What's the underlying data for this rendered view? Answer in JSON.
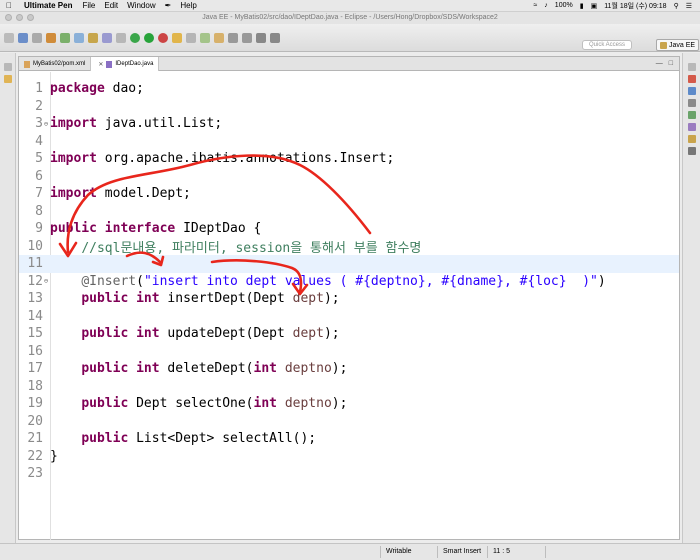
{
  "menubar": {
    "apple": "",
    "app_name": "Ultimate Pen",
    "items": [
      "File",
      "Edit",
      "Window",
      "Help"
    ],
    "battery": "100%",
    "datetime": "11월 18일 (수)  09:18"
  },
  "window": {
    "title": "Java EE - MyBatis02/src/dao/IDeptDao.java - Eclipse - /Users/Hong/Dropbox/SDS/Workspace2"
  },
  "toolbar": {
    "quick_access_placeholder": "Quick Access",
    "perspective_label": "Java EE"
  },
  "editor": {
    "tabs": [
      {
        "label": "MyBatis02/pom.xml",
        "active": false
      },
      {
        "label": "IDeptDao.java",
        "active": true
      }
    ],
    "current_line": 11,
    "lines": [
      {
        "n": "1",
        "fold": "",
        "tokens": [
          {
            "t": "package",
            "c": "kw"
          },
          {
            "t": " dao;",
            "c": ""
          }
        ]
      },
      {
        "n": "2",
        "fold": "",
        "tokens": []
      },
      {
        "n": "3",
        "fold": "⊖",
        "tokens": [
          {
            "t": "import",
            "c": "kw"
          },
          {
            "t": " java.util.List;",
            "c": ""
          }
        ]
      },
      {
        "n": "4",
        "fold": "",
        "tokens": []
      },
      {
        "n": "5",
        "fold": "",
        "tokens": [
          {
            "t": "import",
            "c": "kw"
          },
          {
            "t": " org.apache.ibatis.annotations.Insert;",
            "c": ""
          }
        ]
      },
      {
        "n": "6",
        "fold": "",
        "tokens": []
      },
      {
        "n": "7",
        "fold": "",
        "tokens": [
          {
            "t": "import",
            "c": "kw"
          },
          {
            "t": " model.Dept;",
            "c": ""
          }
        ]
      },
      {
        "n": "8",
        "fold": "",
        "tokens": []
      },
      {
        "n": "9",
        "fold": "",
        "tokens": [
          {
            "t": "public",
            "c": "kw"
          },
          {
            "t": " ",
            "c": ""
          },
          {
            "t": "interface",
            "c": "kw"
          },
          {
            "t": " IDeptDao {",
            "c": ""
          }
        ]
      },
      {
        "n": "10",
        "fold": "",
        "tokens": [
          {
            "t": "    ",
            "c": ""
          },
          {
            "t": "//sql문내용, 파라미터, session을 통해서 부를 함수명",
            "c": "cm"
          }
        ]
      },
      {
        "n": "11",
        "fold": "",
        "tokens": []
      },
      {
        "n": "12",
        "fold": "⊖",
        "tokens": [
          {
            "t": "    ",
            "c": ""
          },
          {
            "t": "@Insert",
            "c": "ann"
          },
          {
            "t": "(",
            "c": ""
          },
          {
            "t": "\"insert into dept values ( #{deptno}, #{dname}, #{loc}  )\"",
            "c": "str"
          },
          {
            "t": ")",
            "c": ""
          }
        ]
      },
      {
        "n": "13",
        "fold": "",
        "tokens": [
          {
            "t": "    ",
            "c": ""
          },
          {
            "t": "public",
            "c": "kw"
          },
          {
            "t": " ",
            "c": ""
          },
          {
            "t": "int",
            "c": "kw"
          },
          {
            "t": " insertDept(Dept ",
            "c": ""
          },
          {
            "t": "dept",
            "c": "var"
          },
          {
            "t": ");",
            "c": ""
          }
        ]
      },
      {
        "n": "14",
        "fold": "",
        "tokens": []
      },
      {
        "n": "15",
        "fold": "",
        "tokens": [
          {
            "t": "    ",
            "c": ""
          },
          {
            "t": "public",
            "c": "kw"
          },
          {
            "t": " ",
            "c": ""
          },
          {
            "t": "int",
            "c": "kw"
          },
          {
            "t": " updateDept(Dept ",
            "c": ""
          },
          {
            "t": "dept",
            "c": "var"
          },
          {
            "t": ");",
            "c": ""
          }
        ]
      },
      {
        "n": "16",
        "fold": "",
        "tokens": []
      },
      {
        "n": "17",
        "fold": "",
        "tokens": [
          {
            "t": "    ",
            "c": ""
          },
          {
            "t": "public",
            "c": "kw"
          },
          {
            "t": " ",
            "c": ""
          },
          {
            "t": "int",
            "c": "kw"
          },
          {
            "t": " deleteDept(",
            "c": ""
          },
          {
            "t": "int",
            "c": "kw"
          },
          {
            "t": " ",
            "c": ""
          },
          {
            "t": "deptno",
            "c": "var"
          },
          {
            "t": ");",
            "c": ""
          }
        ]
      },
      {
        "n": "18",
        "fold": "",
        "tokens": []
      },
      {
        "n": "19",
        "fold": "",
        "tokens": [
          {
            "t": "    ",
            "c": ""
          },
          {
            "t": "public",
            "c": "kw"
          },
          {
            "t": " Dept selectOne(",
            "c": ""
          },
          {
            "t": "int",
            "c": "kw"
          },
          {
            "t": " ",
            "c": ""
          },
          {
            "t": "deptno",
            "c": "var"
          },
          {
            "t": ");",
            "c": ""
          }
        ]
      },
      {
        "n": "20",
        "fold": "",
        "tokens": []
      },
      {
        "n": "21",
        "fold": "",
        "tokens": [
          {
            "t": "    ",
            "c": ""
          },
          {
            "t": "public",
            "c": "kw"
          },
          {
            "t": " List<Dept> selectAll();",
            "c": ""
          }
        ]
      },
      {
        "n": "22",
        "fold": "",
        "tokens": [
          {
            "t": "}",
            "c": ""
          }
        ]
      },
      {
        "n": "23",
        "fold": "",
        "tokens": []
      }
    ]
  },
  "statusbar": {
    "mode": "Writable",
    "insert_mode": "Smart Insert",
    "position": "11 : 5"
  },
  "colors": {
    "keyword": "#7f0055",
    "comment": "#3f7f5f",
    "string": "#2a00ff",
    "annotation_pen": "#e8261c"
  }
}
